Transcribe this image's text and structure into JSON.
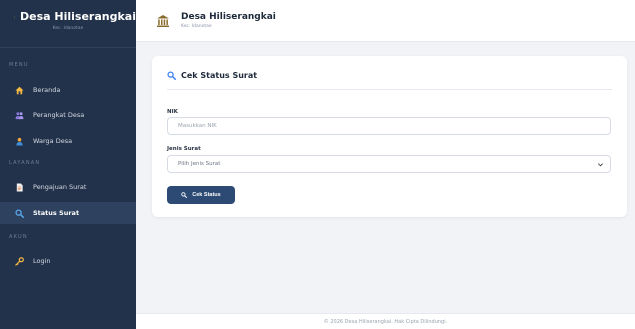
{
  "sidebar": {
    "brand_title": "Desa Hiliserangkai",
    "brand_sub": "Kec. Idanotae",
    "sections": {
      "menu": "MENU",
      "layanan": "LAYANAN",
      "akun": "AKUN"
    },
    "items": [
      {
        "label": "Beranda",
        "icon": "home-icon"
      },
      {
        "label": "Perangkat Desa",
        "icon": "users-icon"
      },
      {
        "label": "Warga Desa",
        "icon": "user-icon"
      },
      {
        "label": "Pengajuan Surat",
        "icon": "document-icon"
      },
      {
        "label": "Status Surat",
        "icon": "search-icon",
        "active": true
      },
      {
        "label": "Login",
        "icon": "key-icon"
      }
    ]
  },
  "header": {
    "title": "Desa Hiliserangkai",
    "subtitle": "Kec. Idanotae"
  },
  "card": {
    "title": "Cek Status Surat",
    "nik_label": "NIK",
    "nik_placeholder": "Masukkan NIK",
    "jenis_label": "Jenis Surat",
    "jenis_selected": "Pilih Jenis Surat",
    "button_label": "Cek Status"
  },
  "footer": {
    "text": "© 2026 Desa Hiliserangkai. Hak Cipta Dilindungi."
  },
  "colors": {
    "sidebar_bg": "#22324a",
    "active_bg": "#2e4260",
    "button_bg": "#2c4a73",
    "accent_search": "#3b82f6"
  }
}
